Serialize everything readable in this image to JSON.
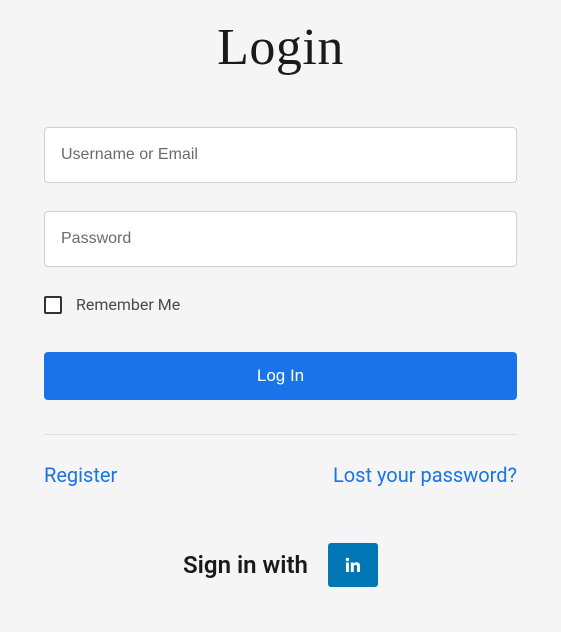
{
  "heading": "Login",
  "fields": {
    "username_placeholder": "Username or Email",
    "password_placeholder": "Password"
  },
  "remember_label": "Remember Me",
  "login_button": "Log In",
  "links": {
    "register": "Register",
    "lost_password": "Lost your password?"
  },
  "social": {
    "label": "Sign in with",
    "provider": "linkedin"
  }
}
